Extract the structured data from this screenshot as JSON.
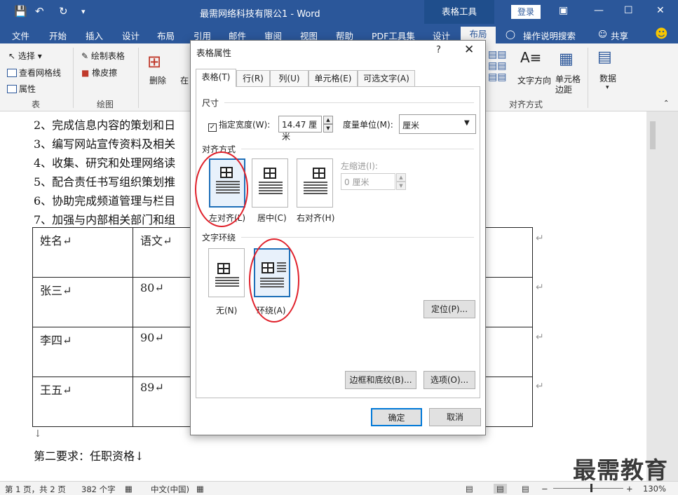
{
  "titlebar": {
    "doc_title": "最需网络科技有限公1 - Word",
    "context_tab": "表格工具",
    "login": "登录",
    "icons": [
      "save-icon",
      "undo-icon",
      "redo-icon",
      "customize-icon"
    ]
  },
  "tabs": [
    "文件",
    "开始",
    "插入",
    "设计",
    "布局",
    "引用",
    "邮件",
    "审阅",
    "视图",
    "帮助",
    "PDF工具集",
    "设计",
    "布局"
  ],
  "tell_me": "操作说明搜索",
  "share": "共享",
  "ribbon": {
    "select": "选择",
    "view_gridlines": "查看网格线",
    "properties": "属性",
    "group_table": "表",
    "draw_table": "绘制表格",
    "eraser": "橡皮擦",
    "group_draw": "绘图",
    "delete": "删除",
    "insert_partial": "在",
    "text_direction": "文字方向",
    "cell_margins": "单元格边距",
    "group_align": "对齐方式",
    "data": "数据"
  },
  "document": {
    "lines": [
      "2、完成信息内容的策划和日",
      "3、编写网站宣传资料及相关",
      "4、收集、研究和处理网络读",
      "5、配合责任书写组织策划推",
      "6、协助完成频道管理与栏目",
      "7、加强与内部相关部门和组"
    ],
    "table": [
      [
        "姓名↵",
        "语文↵"
      ],
      [
        "张三↵",
        "80↵"
      ],
      [
        "李四↵",
        "90↵"
      ],
      [
        "王五↵",
        "89↵"
      ]
    ],
    "after_table": "↓",
    "section2": "第二要求：任职资格↓",
    "return_mark": "↵"
  },
  "dialog": {
    "title": "表格属性",
    "help": "?",
    "tabs": [
      "表格(T)",
      "行(R)",
      "列(U)",
      "单元格(E)",
      "可选文字(A)"
    ],
    "size_section": "尺寸",
    "specify_width": "指定宽度(W):",
    "width_value": "14.47 厘米",
    "measure_label": "度量单位(M):",
    "measure_value": "厘米",
    "alignment_section": "对齐方式",
    "align_left": "左对齐(L)",
    "align_center": "居中(C)",
    "align_right": "右对齐(H)",
    "indent_label": "左缩进(I):",
    "indent_value": "0 厘米",
    "wrap_section": "文字环绕",
    "wrap_none": "无(N)",
    "wrap_around": "环绕(A)",
    "positioning": "定位(P)...",
    "borders": "边框和底纹(B)...",
    "options": "选项(O)...",
    "ok": "确定",
    "cancel": "取消"
  },
  "statusbar": {
    "page": "第 1 页，共 2 页",
    "words": "382 个字",
    "language": "中文(中国)",
    "zoom": "130%",
    "zoom_minus": "−",
    "zoom_plus": "+"
  },
  "watermark": "最需教育"
}
